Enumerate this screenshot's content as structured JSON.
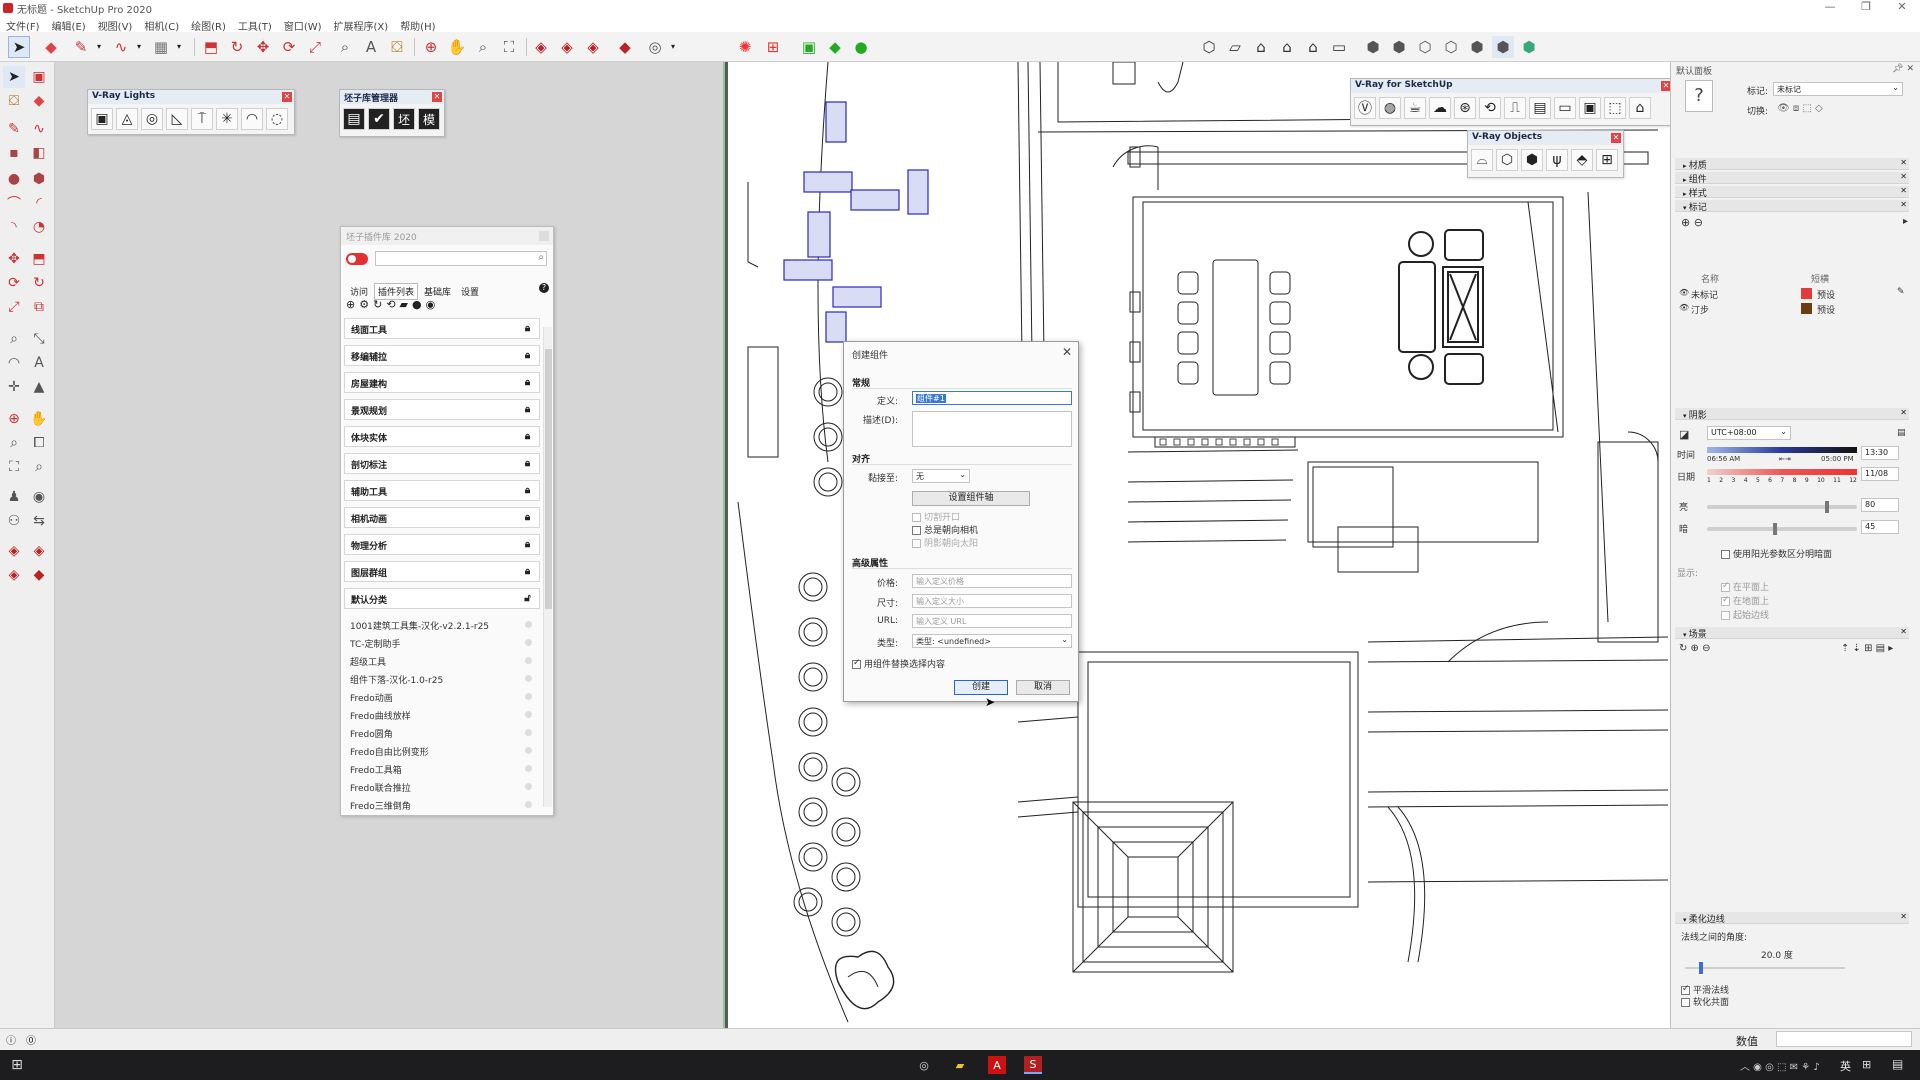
{
  "window": {
    "title": "无标题 - SketchUp Pro 2020",
    "controls": [
      "—",
      "❐",
      "✕"
    ]
  },
  "menu": [
    "文件(F)",
    "编辑(E)",
    "视图(V)",
    "相机(C)",
    "绘图(R)",
    "工具(T)",
    "窗口(W)",
    "扩展程序(X)",
    "帮助(H)"
  ],
  "floating": {
    "vray_lights": {
      "title": "V-Ray Lights"
    },
    "plugin_manager": {
      "title": "坯子库管理器",
      "icons": [
        "▤",
        "✔",
        "坯",
        "模"
      ]
    },
    "vray_sketchup": {
      "title": "V-Ray for SketchUp"
    },
    "vray_objects": {
      "title": "V-Ray Objects"
    }
  },
  "library": {
    "title": "坯子插件库 2020",
    "tabs": [
      "访问",
      "插件列表",
      "基础库",
      "设置"
    ],
    "help": "?",
    "categories": [
      "线面工具",
      "移编辅拉",
      "房屋建构",
      "景观规划",
      "体块实体",
      "剖切标注",
      "辅助工具",
      "相机动画",
      "物理分析",
      "图层群组",
      "默认分类"
    ],
    "plugins": [
      "1001建筑工具集-汉化-v2.2.1-r25",
      "TC-定制助手",
      "超级工具",
      "组件下落-汉化-1.0-r25",
      "Fredo动画",
      "Fredo曲线放样",
      "Fredo圆角",
      "Fredo自由比例变形",
      "Fredo工具箱",
      "Fredo联合推拉",
      "Fredo三维倒角"
    ]
  },
  "dialog": {
    "title": "创建组件",
    "close": "✕",
    "section_general": "常规",
    "label_define": "定义:",
    "define_value": "组件#1",
    "label_desc": "描述(D):",
    "section_align": "对齐",
    "label_glue": "黏接至:",
    "glue_value": "无",
    "set_axis": "设置组件轴",
    "cut_opening": "切割开口",
    "always_face_camera": "总是朝向相机",
    "shadows_face_sun": "阴影朝向太阳",
    "section_advanced": "高级属性",
    "label_price": "价格:",
    "price_placeholder": "输入定义价格",
    "label_size": "尺寸:",
    "size_placeholder": "输入定义大小",
    "label_url": "URL:",
    "url_placeholder": "输入定义 URL",
    "label_type": "类型:",
    "type_value": "类型: <undefined>",
    "replace_selection": "用组件替换选择内容",
    "create_btn": "创建",
    "cancel_btn": "取消"
  },
  "tray": {
    "title": "默认面板",
    "tag_label": "标记:",
    "tag_value": "未标记",
    "toggle_label": "切换:",
    "sections_top": [
      "材质",
      "组件",
      "样式",
      "标记"
    ],
    "tags_header_name": "名称",
    "tags_header_dash": "短横",
    "tags": [
      {
        "name": "未标记",
        "dash": "预设",
        "color": "#e23b3b"
      },
      {
        "name": "汀步",
        "dash": "预设",
        "color": "#6b3d10"
      }
    ],
    "shadows": {
      "section": "阴影",
      "tz": "UTC+08:00",
      "time_label": "时间",
      "time_value": "13:30",
      "time_am": "06:56 AM",
      "time_pm": "05:00 PM",
      "date_label": "日期",
      "date_value": "11/08",
      "months": [
        "1",
        "2",
        "3",
        "4",
        "5",
        "6",
        "7",
        "8",
        "9",
        "10",
        "11",
        "12"
      ],
      "light_label": "亮",
      "light_value": "80",
      "dark_label": "暗",
      "dark_value": "45",
      "use_sun": "使用阳光参数区分明暗面",
      "display_label": "显示:",
      "on_faces": "在平面上",
      "on_ground": "在地面上",
      "from_edges": "起始边线"
    },
    "scenes": {
      "section": "场景"
    },
    "soften": {
      "section": "柔化边线",
      "angle_label": "法线之间的角度:",
      "angle_value": "20.0  度",
      "smooth": "平滑法线",
      "soften_coplanar": "软化共面"
    }
  },
  "status": {
    "measure_label": "数值"
  },
  "taskbar": {
    "ime": "英"
  }
}
